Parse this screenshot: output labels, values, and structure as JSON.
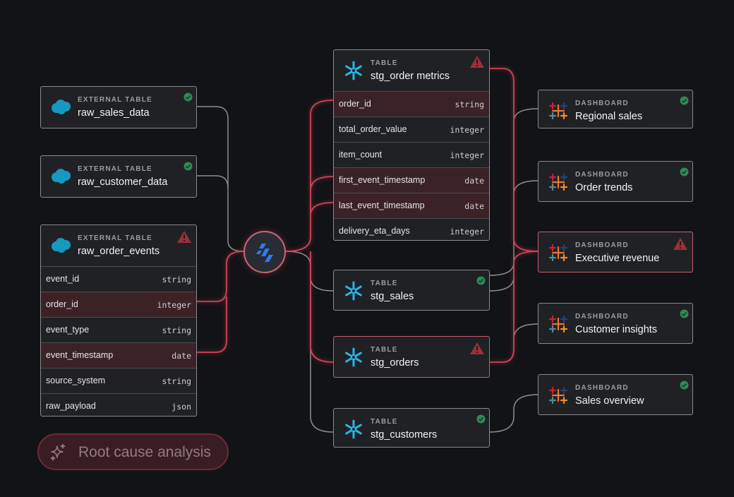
{
  "sources": [
    {
      "id": "raw_sales_data",
      "type_label": "EXTERNAL TABLE",
      "name": "raw_sales_data",
      "status": "ok"
    },
    {
      "id": "raw_customer_data",
      "type_label": "EXTERNAL TABLE",
      "name": "raw_customer_data",
      "status": "ok"
    },
    {
      "id": "raw_order_events",
      "type_label": "EXTERNAL TABLE",
      "name": "raw_order_events",
      "status": "warning",
      "fields": [
        {
          "name": "event_id",
          "type": "string",
          "highlighted": false
        },
        {
          "name": "order_id",
          "type": "integer",
          "highlighted": true
        },
        {
          "name": "event_type",
          "type": "string",
          "highlighted": false
        },
        {
          "name": "event_timestamp",
          "type": "date",
          "highlighted": true
        },
        {
          "name": "source_system",
          "type": "string",
          "highlighted": false
        },
        {
          "name": "raw_payload",
          "type": "json",
          "highlighted": false
        }
      ]
    }
  ],
  "models": [
    {
      "id": "stg_order_metrics",
      "type_label": "TABLE",
      "name": "stg_order metrics",
      "status": "warning",
      "fields": [
        {
          "name": "order_id",
          "type": "string",
          "highlighted": true
        },
        {
          "name": "total_order_value",
          "type": "integer",
          "highlighted": false
        },
        {
          "name": "item_count",
          "type": "integer",
          "highlighted": false
        },
        {
          "name": "first_event_timestamp",
          "type": "date",
          "highlighted": true
        },
        {
          "name": "last_event_timestamp",
          "type": "date",
          "highlighted": true
        },
        {
          "name": "delivery_eta_days",
          "type": "integer",
          "highlighted": false
        }
      ]
    },
    {
      "id": "stg_sales",
      "type_label": "TABLE",
      "name": "stg_sales",
      "status": "ok"
    },
    {
      "id": "stg_orders",
      "type_label": "TABLE",
      "name": "stg_orders",
      "status": "warning"
    },
    {
      "id": "stg_customers",
      "type_label": "TABLE",
      "name": "stg_customers",
      "status": "ok"
    }
  ],
  "dashboards": [
    {
      "id": "regional_sales",
      "type_label": "DASHBOARD",
      "name": "Regional sales",
      "status": "ok"
    },
    {
      "id": "order_trends",
      "type_label": "DASHBOARD",
      "name": "Order trends",
      "status": "ok"
    },
    {
      "id": "executive_revenue",
      "type_label": "DASHBOARD",
      "name": "Executive revenue",
      "status": "warning"
    },
    {
      "id": "customer_insights",
      "type_label": "DASHBOARD",
      "name": "Customer insights",
      "status": "ok"
    },
    {
      "id": "sales_overview",
      "type_label": "DASHBOARD",
      "name": "Sales overview",
      "status": "ok"
    }
  ],
  "actions": {
    "root_cause_label": "Root cause analysis"
  },
  "colors": {
    "background": "#121316",
    "card": "#202124",
    "ok": "#2f8a57",
    "warning": "#d4404f",
    "impact_wire": "#d04458",
    "neutral_wire": "#8e8e91",
    "snowflake": "#29b5e8",
    "salesforce": "#1798c1"
  },
  "icons": {
    "source_logo": "salesforce-logo",
    "model_logo": "snowflake-logo",
    "dashboard_logo": "tableau-logo",
    "hub_logo": "lineage-hub-logo",
    "ok_status": "check-circle-icon",
    "warning_status": "warning-triangle-icon",
    "action_icon": "sparkle-icon"
  }
}
